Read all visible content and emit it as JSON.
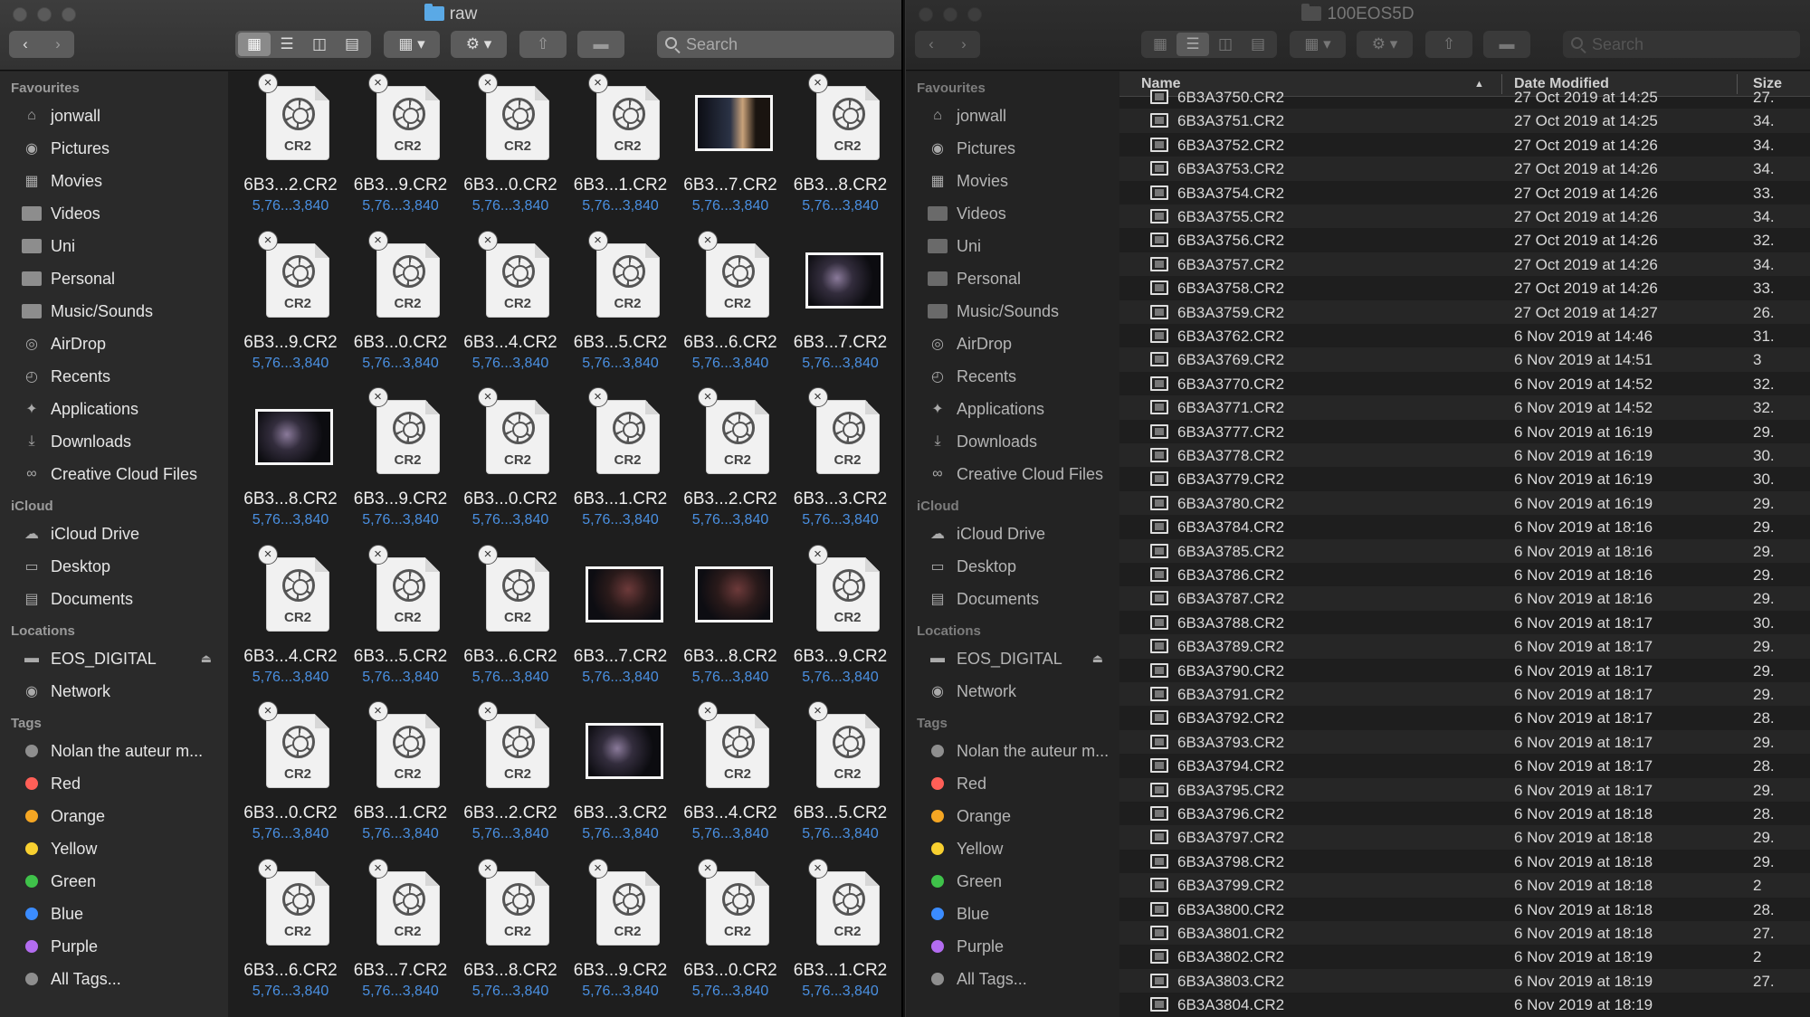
{
  "left_window": {
    "title": "raw",
    "search_placeholder": "Search",
    "sidebar": {
      "sections": [
        {
          "header": "Favourites",
          "items": [
            {
              "label": "jonwall",
              "icon": "home-icon"
            },
            {
              "label": "Pictures",
              "icon": "camera-icon"
            },
            {
              "label": "Movies",
              "icon": "film-icon"
            },
            {
              "label": "Videos",
              "icon": "folder-icon"
            },
            {
              "label": "Uni",
              "icon": "folder-icon"
            },
            {
              "label": "Personal",
              "icon": "folder-icon"
            },
            {
              "label": "Music/Sounds",
              "icon": "folder-icon"
            },
            {
              "label": "AirDrop",
              "icon": "airdrop-icon"
            },
            {
              "label": "Recents",
              "icon": "clock-icon"
            },
            {
              "label": "Applications",
              "icon": "applications-icon"
            },
            {
              "label": "Downloads",
              "icon": "download-icon"
            },
            {
              "label": "Creative Cloud Files",
              "icon": "creative-cloud-icon"
            }
          ]
        },
        {
          "header": "iCloud",
          "items": [
            {
              "label": "iCloud Drive",
              "icon": "cloud-icon"
            },
            {
              "label": "Desktop",
              "icon": "desktop-icon"
            },
            {
              "label": "Documents",
              "icon": "document-icon"
            }
          ]
        },
        {
          "header": "Locations",
          "items": [
            {
              "label": "EOS_DIGITAL",
              "icon": "drive-icon"
            },
            {
              "label": "Network",
              "icon": "network-icon"
            }
          ]
        },
        {
          "header": "Tags",
          "items": [
            {
              "label": "Nolan the auteur m...",
              "color": "#8e8e8e"
            },
            {
              "label": "Red",
              "color": "#ff5f57"
            },
            {
              "label": "Orange",
              "color": "#f5a623"
            },
            {
              "label": "Yellow",
              "color": "#f8d030"
            },
            {
              "label": "Green",
              "color": "#3fc24a"
            },
            {
              "label": "Blue",
              "color": "#3b8cff"
            },
            {
              "label": "Purple",
              "color": "#b36cf0"
            },
            {
              "label": "All Tags...",
              "color": "#8e8e8e"
            }
          ]
        }
      ]
    },
    "files": [
      {
        "name": "6B3...2.CR2",
        "sub": "5,76...3,840",
        "kind": "doc"
      },
      {
        "name": "6B3...9.CR2",
        "sub": "5,76...3,840",
        "kind": "doc"
      },
      {
        "name": "6B3...0.CR2",
        "sub": "5,76...3,840",
        "kind": "doc"
      },
      {
        "name": "6B3...1.CR2",
        "sub": "5,76...3,840",
        "kind": "doc"
      },
      {
        "name": "6B3...7.CR2",
        "sub": "5,76...3,840",
        "kind": "thumb",
        "style": "c"
      },
      {
        "name": "6B3...8.CR2",
        "sub": "5,76...3,840",
        "kind": "doc"
      },
      {
        "name": "6B3...9.CR2",
        "sub": "5,76...3,840",
        "kind": "doc"
      },
      {
        "name": "6B3...0.CR2",
        "sub": "5,76...3,840",
        "kind": "doc"
      },
      {
        "name": "6B3...4.CR2",
        "sub": "5,76...3,840",
        "kind": "doc"
      },
      {
        "name": "6B3...5.CR2",
        "sub": "5,76...3,840",
        "kind": "doc"
      },
      {
        "name": "6B3...6.CR2",
        "sub": "5,76...3,840",
        "kind": "doc"
      },
      {
        "name": "6B3...7.CR2",
        "sub": "5,76...3,840",
        "kind": "thumb",
        "style": "b"
      },
      {
        "name": "6B3...8.CR2",
        "sub": "5,76...3,840",
        "kind": "thumb",
        "style": "b"
      },
      {
        "name": "6B3...9.CR2",
        "sub": "5,76...3,840",
        "kind": "doc"
      },
      {
        "name": "6B3...0.CR2",
        "sub": "5,76...3,840",
        "kind": "doc"
      },
      {
        "name": "6B3...1.CR2",
        "sub": "5,76...3,840",
        "kind": "doc"
      },
      {
        "name": "6B3...2.CR2",
        "sub": "5,76...3,840",
        "kind": "doc"
      },
      {
        "name": "6B3...3.CR2",
        "sub": "5,76...3,840",
        "kind": "doc"
      },
      {
        "name": "6B3...4.CR2",
        "sub": "5,76...3,840",
        "kind": "doc"
      },
      {
        "name": "6B3...5.CR2",
        "sub": "5,76...3,840",
        "kind": "doc"
      },
      {
        "name": "6B3...6.CR2",
        "sub": "5,76...3,840",
        "kind": "doc"
      },
      {
        "name": "6B3...7.CR2",
        "sub": "5,76...3,840",
        "kind": "thumb",
        "style": "a"
      },
      {
        "name": "6B3...8.CR2",
        "sub": "5,76...3,840",
        "kind": "thumb",
        "style": "a"
      },
      {
        "name": "6B3...9.CR2",
        "sub": "5,76...3,840",
        "kind": "doc"
      },
      {
        "name": "6B3...0.CR2",
        "sub": "5,76...3,840",
        "kind": "doc"
      },
      {
        "name": "6B3...1.CR2",
        "sub": "5,76...3,840",
        "kind": "doc"
      },
      {
        "name": "6B3...2.CR2",
        "sub": "5,76...3,840",
        "kind": "doc"
      },
      {
        "name": "6B3...3.CR2",
        "sub": "5,76...3,840",
        "kind": "thumb",
        "style": "b"
      },
      {
        "name": "6B3...4.CR2",
        "sub": "5,76...3,840",
        "kind": "doc"
      },
      {
        "name": "6B3...5.CR2",
        "sub": "5,76...3,840",
        "kind": "doc"
      },
      {
        "name": "6B3...6.CR2",
        "sub": "5,76...3,840",
        "kind": "doc"
      },
      {
        "name": "6B3...7.CR2",
        "sub": "5,76...3,840",
        "kind": "doc"
      },
      {
        "name": "6B3...8.CR2",
        "sub": "5,76...3,840",
        "kind": "doc"
      },
      {
        "name": "6B3...9.CR2",
        "sub": "5,76...3,840",
        "kind": "doc"
      },
      {
        "name": "6B3...0.CR2",
        "sub": "5,76...3,840",
        "kind": "doc"
      },
      {
        "name": "6B3...1.CR2",
        "sub": "5,76...3,840",
        "kind": "doc"
      }
    ],
    "doc_label": "CR2"
  },
  "right_window": {
    "title": "100EOS5D",
    "search_placeholder": "Search",
    "columns": {
      "name": "Name",
      "date": "Date Modified",
      "size": "Size"
    },
    "rows": [
      {
        "name": "6B3A3750.CR2",
        "date": "27 Oct 2019 at 14:25",
        "size": "27."
      },
      {
        "name": "6B3A3751.CR2",
        "date": "27 Oct 2019 at 14:25",
        "size": "34."
      },
      {
        "name": "6B3A3752.CR2",
        "date": "27 Oct 2019 at 14:26",
        "size": "34."
      },
      {
        "name": "6B3A3753.CR2",
        "date": "27 Oct 2019 at 14:26",
        "size": "34."
      },
      {
        "name": "6B3A3754.CR2",
        "date": "27 Oct 2019 at 14:26",
        "size": "33."
      },
      {
        "name": "6B3A3755.CR2",
        "date": "27 Oct 2019 at 14:26",
        "size": "34."
      },
      {
        "name": "6B3A3756.CR2",
        "date": "27 Oct 2019 at 14:26",
        "size": "32."
      },
      {
        "name": "6B3A3757.CR2",
        "date": "27 Oct 2019 at 14:26",
        "size": "34."
      },
      {
        "name": "6B3A3758.CR2",
        "date": "27 Oct 2019 at 14:26",
        "size": "33."
      },
      {
        "name": "6B3A3759.CR2",
        "date": "27 Oct 2019 at 14:27",
        "size": "26."
      },
      {
        "name": "6B3A3762.CR2",
        "date": "6 Nov 2019 at 14:46",
        "size": "31."
      },
      {
        "name": "6B3A3769.CR2",
        "date": "6 Nov 2019 at 14:51",
        "size": "3"
      },
      {
        "name": "6B3A3770.CR2",
        "date": "6 Nov 2019 at 14:52",
        "size": "32."
      },
      {
        "name": "6B3A3771.CR2",
        "date": "6 Nov 2019 at 14:52",
        "size": "32."
      },
      {
        "name": "6B3A3777.CR2",
        "date": "6 Nov 2019 at 16:19",
        "size": "29."
      },
      {
        "name": "6B3A3778.CR2",
        "date": "6 Nov 2019 at 16:19",
        "size": "30."
      },
      {
        "name": "6B3A3779.CR2",
        "date": "6 Nov 2019 at 16:19",
        "size": "30."
      },
      {
        "name": "6B3A3780.CR2",
        "date": "6 Nov 2019 at 16:19",
        "size": "29."
      },
      {
        "name": "6B3A3784.CR2",
        "date": "6 Nov 2019 at 18:16",
        "size": "29."
      },
      {
        "name": "6B3A3785.CR2",
        "date": "6 Nov 2019 at 18:16",
        "size": "29."
      },
      {
        "name": "6B3A3786.CR2",
        "date": "6 Nov 2019 at 18:16",
        "size": "29."
      },
      {
        "name": "6B3A3787.CR2",
        "date": "6 Nov 2019 at 18:16",
        "size": "29."
      },
      {
        "name": "6B3A3788.CR2",
        "date": "6 Nov 2019 at 18:17",
        "size": "30."
      },
      {
        "name": "6B3A3789.CR2",
        "date": "6 Nov 2019 at 18:17",
        "size": "29."
      },
      {
        "name": "6B3A3790.CR2",
        "date": "6 Nov 2019 at 18:17",
        "size": "29."
      },
      {
        "name": "6B3A3791.CR2",
        "date": "6 Nov 2019 at 18:17",
        "size": "29."
      },
      {
        "name": "6B3A3792.CR2",
        "date": "6 Nov 2019 at 18:17",
        "size": "28."
      },
      {
        "name": "6B3A3793.CR2",
        "date": "6 Nov 2019 at 18:17",
        "size": "29."
      },
      {
        "name": "6B3A3794.CR2",
        "date": "6 Nov 2019 at 18:17",
        "size": "28."
      },
      {
        "name": "6B3A3795.CR2",
        "date": "6 Nov 2019 at 18:17",
        "size": "29."
      },
      {
        "name": "6B3A3796.CR2",
        "date": "6 Nov 2019 at 18:18",
        "size": "28."
      },
      {
        "name": "6B3A3797.CR2",
        "date": "6 Nov 2019 at 18:18",
        "size": "29."
      },
      {
        "name": "6B3A3798.CR2",
        "date": "6 Nov 2019 at 18:18",
        "size": "29."
      },
      {
        "name": "6B3A3799.CR2",
        "date": "6 Nov 2019 at 18:18",
        "size": "2"
      },
      {
        "name": "6B3A3800.CR2",
        "date": "6 Nov 2019 at 18:18",
        "size": "28."
      },
      {
        "name": "6B3A3801.CR2",
        "date": "6 Nov 2019 at 18:18",
        "size": "27."
      },
      {
        "name": "6B3A3802.CR2",
        "date": "6 Nov 2019 at 18:19",
        "size": "2"
      },
      {
        "name": "6B3A3803.CR2",
        "date": "6 Nov 2019 at 18:19",
        "size": "27."
      },
      {
        "name": "6B3A3804.CR2",
        "date": "6 Nov 2019 at 18:19",
        "size": ""
      }
    ]
  }
}
